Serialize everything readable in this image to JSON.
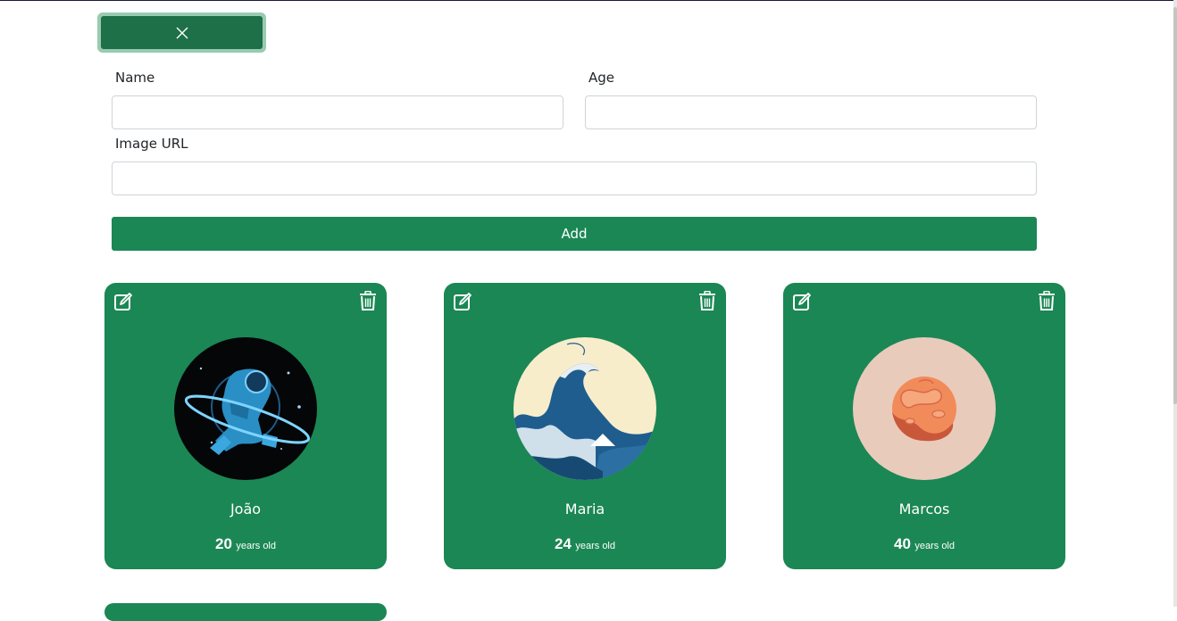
{
  "toggle_button": {
    "icon": "close-icon"
  },
  "form": {
    "name_label": "Name",
    "name_value": "",
    "age_label": "Age",
    "age_value": "",
    "image_label": "Image URL",
    "image_value": "",
    "add_label": "Add"
  },
  "cards": [
    {
      "name": "João",
      "age": "20",
      "age_unit": "years old"
    },
    {
      "name": "Maria",
      "age": "24",
      "age_unit": "years old"
    },
    {
      "name": "Marcos",
      "age": "40",
      "age_unit": "years old"
    }
  ],
  "colors": {
    "primary": "#1b8754",
    "toggle_dark": "#1d7048",
    "toggle_ring": "#98cbb1",
    "input_border": "#cfd4d9"
  }
}
